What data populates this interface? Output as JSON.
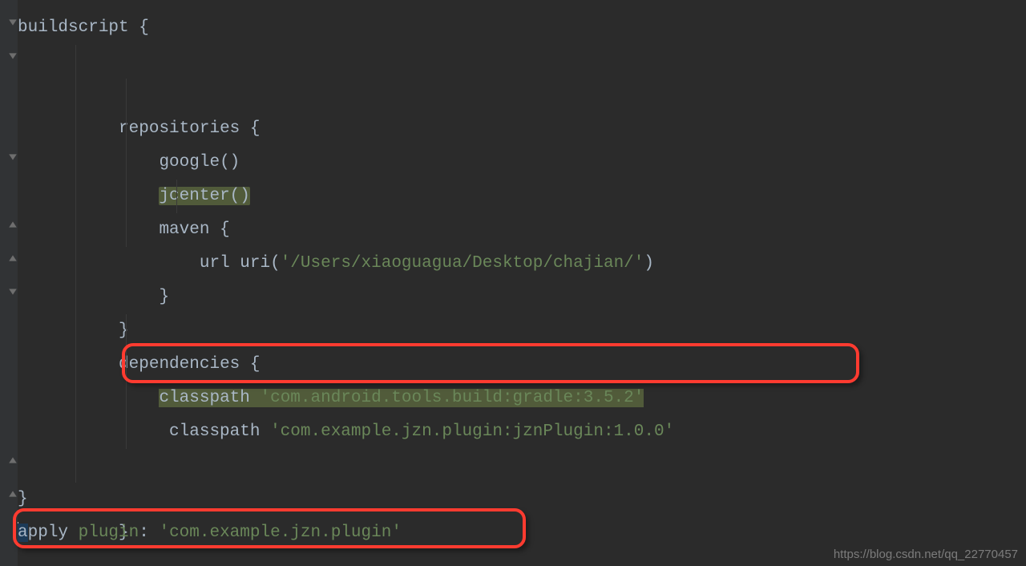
{
  "code": {
    "l1_buildscript": "buildscript ",
    "l1_brace": "{",
    "l2_repositories": "repositories ",
    "l2_brace": "{",
    "l3_google": "google()",
    "l4_jcenter": "jcenter()",
    "l5_maven": "maven ",
    "l5_brace": "{",
    "l6_url": "url ",
    "l6_uri": "uri",
    "l6_paren_open": "(",
    "l6_path": "'/Users/xiaoguagua/Desktop/chajian/'",
    "l6_paren_close": ")",
    "l7_close": "}",
    "l8_close": "}",
    "l9_dependencies": "dependencies ",
    "l9_brace": "{",
    "l10_classpath": "classpath ",
    "l10_dep": "'com.android.tools.build:gradle:3.5.2'",
    "l11_classpath": "classpath ",
    "l11_dep": "'com.example.jzn.plugin:jznPlugin:1.0.0'",
    "l14_close": "}",
    "l15_close": "}",
    "l16_a": "a",
    "l16_pply": "pply ",
    "l16_plugin": "plugin",
    "l16_colon": ": ",
    "l16_value": "'com.example.jzn.plugin'"
  },
  "watermark": "https://blog.csdn.net/qq_22770457"
}
